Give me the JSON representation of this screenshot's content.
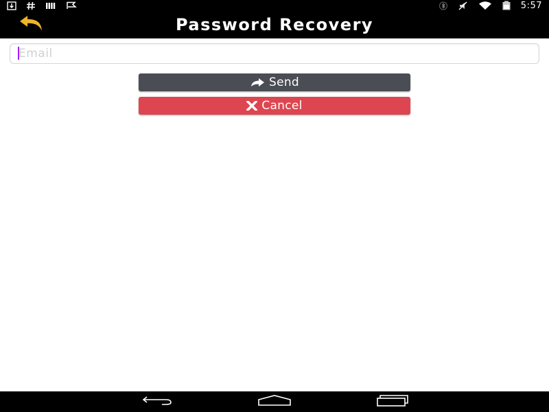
{
  "status_bar": {
    "time": "5:57",
    "left_icons": [
      "download-icon",
      "hash-icon",
      "signal-bars-icon",
      "flag-icon"
    ],
    "right_icons": [
      "bluetooth-icon",
      "mute-icon",
      "wifi-icon",
      "battery-icon"
    ]
  },
  "header": {
    "title": "Password Recovery",
    "back_icon": "undo-arrow-icon",
    "accent_color": "#f0b429"
  },
  "form": {
    "email": {
      "placeholder": "Email",
      "value": ""
    },
    "send_button": {
      "label": "Send",
      "icon": "share-arrow-icon",
      "color": "#4a4d54"
    },
    "cancel_button": {
      "label": "Cancel",
      "icon": "close-x-icon",
      "color": "#dd4650"
    }
  },
  "nav_bar": {
    "buttons": [
      "back-icon",
      "home-icon",
      "recent-apps-icon"
    ]
  }
}
